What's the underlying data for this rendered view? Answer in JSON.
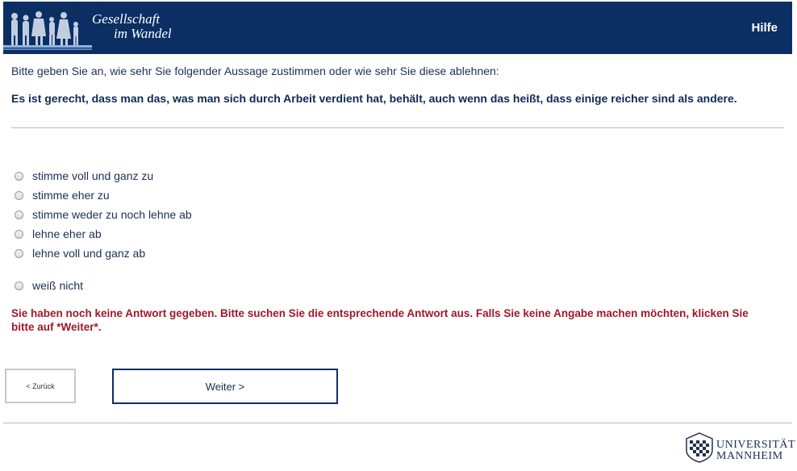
{
  "header": {
    "logo_line1": "Gesellschaft",
    "logo_line2": "im Wandel",
    "help_label": "Hilfe"
  },
  "survey": {
    "instruction": "Bitte geben Sie an, wie sehr Sie folgender Aussage zustimmen oder wie sehr Sie diese ablehnen:",
    "question": "Es ist gerecht, dass man das, was man sich durch Arbeit verdient hat, behält, auch wenn das heißt, dass einige reicher sind als andere.",
    "options": [
      "stimme voll und ganz zu",
      "stimme eher zu",
      "stimme weder zu noch lehne ab",
      "lehne eher ab",
      "lehne voll und ganz ab"
    ],
    "dont_know": "weiß nicht",
    "error_message": "Sie haben noch keine Antwort gegeben. Bitte suchen Sie die entsprechende Antwort aus. Falls Sie keine Angabe machen möchten, klicken Sie bitte auf *Weiter*."
  },
  "navigation": {
    "back_label": "< Zurück",
    "next_label": "Weiter >"
  },
  "footer": {
    "university_line1": "UNIVERSITÄT",
    "university_line2": "MANNHEIM"
  },
  "colors": {
    "header_bg": "#0b2f63",
    "error": "#a0172c",
    "text": "#1e2f52"
  }
}
